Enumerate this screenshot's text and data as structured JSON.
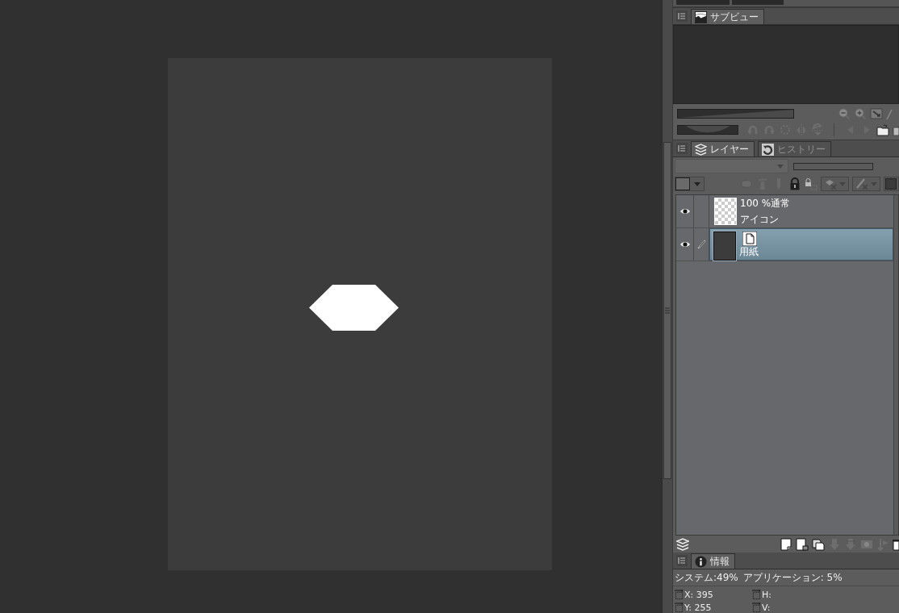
{
  "subview_panel": {
    "tabs": [
      {
        "label": "サブビュー",
        "selected": true
      }
    ]
  },
  "layer_panel": {
    "tabs": [
      {
        "label": "レイヤー",
        "selected": true
      },
      {
        "label": "ヒストリー",
        "selected": false
      }
    ],
    "layers": [
      {
        "kind": "raster",
        "visible": true,
        "editing": false,
        "selected": false,
        "detail": "100 %通常",
        "name": "アイコン"
      },
      {
        "kind": "paper",
        "visible": true,
        "editing": true,
        "selected": true,
        "name": "用紙"
      }
    ]
  },
  "info_panel": {
    "tabs": [
      {
        "label": "情報",
        "selected": true
      }
    ],
    "usage": [
      "システム:49%",
      "アプリケーション: 5%"
    ],
    "coordinates": [
      "X: 395",
      "H:",
      "Y: 255",
      "V:"
    ]
  }
}
